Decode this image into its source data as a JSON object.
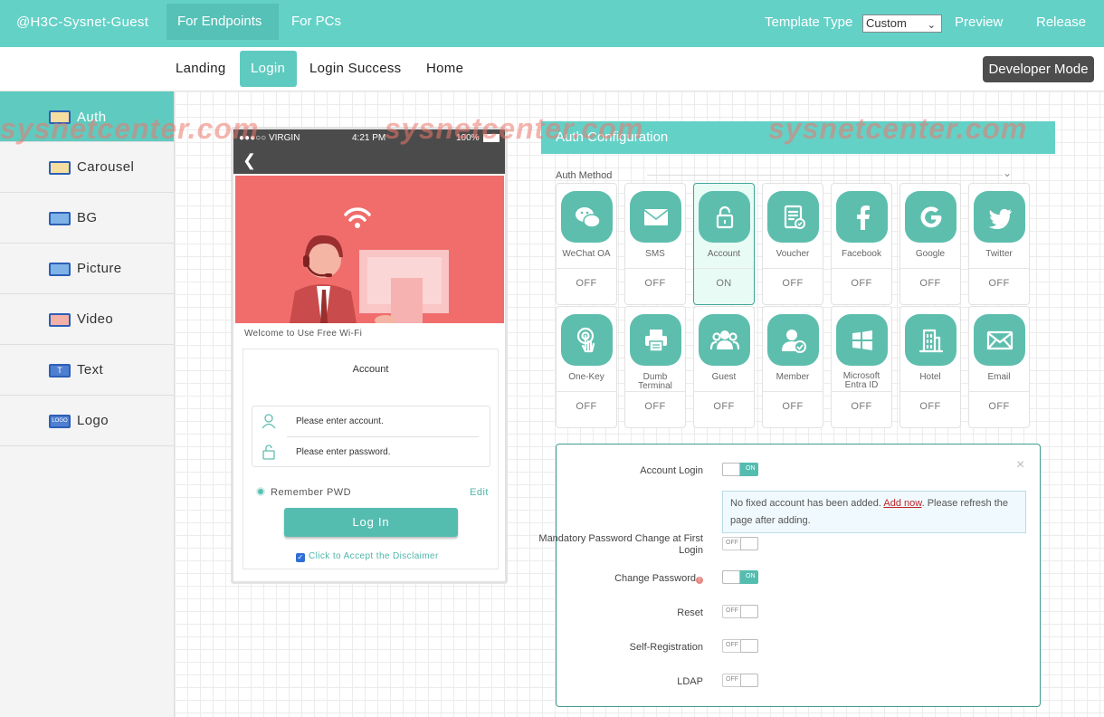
{
  "topbar": {
    "brand": "@H3C-Sysnet-Guest",
    "tabs": [
      "For Endpoints",
      "For PCs"
    ],
    "template_type_label": "Template Type",
    "template_type_value": "Custom",
    "preview": "Preview",
    "release": "Release"
  },
  "pages": {
    "tabs": [
      "Landing",
      "Login",
      "Login Success",
      "Home"
    ],
    "developer_mode": "Developer Mode"
  },
  "sidebar": {
    "items": [
      {
        "label": "Auth"
      },
      {
        "label": "Carousel"
      },
      {
        "label": "BG"
      },
      {
        "label": "Picture"
      },
      {
        "label": "Video"
      },
      {
        "label": "Text"
      },
      {
        "label": "Logo"
      }
    ]
  },
  "phone": {
    "carrier": "●●●○○ VIRGIN",
    "time": "4:21 PM",
    "battery": "100%",
    "welcome": "Welcome to Use Free Wi-Fi",
    "card_title": "Account",
    "account_placeholder": "Please enter account.",
    "password_placeholder": "Please enter password.",
    "remember": "Remember PWD",
    "edit": "Edit",
    "login_button": "Log In",
    "disclaimer": "Click to Accept the Disclaimer"
  },
  "auth": {
    "header": "Auth Configuration",
    "method_label": "Auth Method",
    "accent": "#5ebeae",
    "methods": [
      {
        "name": "WeChat OA",
        "state": "OFF",
        "icon": "wechat-icon"
      },
      {
        "name": "SMS",
        "state": "OFF",
        "icon": "envelope-icon"
      },
      {
        "name": "Account",
        "state": "ON",
        "icon": "lock-icon"
      },
      {
        "name": "Voucher",
        "state": "OFF",
        "icon": "voucher-icon"
      },
      {
        "name": "Facebook",
        "state": "OFF",
        "icon": "facebook-icon"
      },
      {
        "name": "Google",
        "state": "OFF",
        "icon": "google-icon"
      },
      {
        "name": "Twitter",
        "state": "OFF",
        "icon": "twitter-icon"
      },
      {
        "name": "One-Key",
        "state": "OFF",
        "icon": "touch-icon"
      },
      {
        "name": "Dumb Terminal",
        "state": "OFF",
        "icon": "printer-icon"
      },
      {
        "name": "Guest",
        "state": "OFF",
        "icon": "group-icon"
      },
      {
        "name": "Member",
        "state": "OFF",
        "icon": "member-icon"
      },
      {
        "name": "Microsoft Entra ID",
        "state": "OFF",
        "icon": "windows-icon"
      },
      {
        "name": "Hotel",
        "state": "OFF",
        "icon": "building-icon"
      },
      {
        "name": "Email",
        "state": "OFF",
        "icon": "mail-icon"
      }
    ]
  },
  "settings": {
    "rows": [
      {
        "label": "Account Login",
        "state": "ON"
      },
      {
        "label": "Mandatory Password Change at First Login",
        "state": "OFF"
      },
      {
        "label": "Change Password",
        "state": "ON"
      },
      {
        "label": "Reset",
        "state": "OFF"
      },
      {
        "label": "Self-Registration",
        "state": "OFF"
      },
      {
        "label": "LDAP",
        "state": "OFF"
      }
    ],
    "notice_before": "No fixed account has been added. ",
    "notice_link": "Add now",
    "notice_after": ". Please refresh the page after adding."
  },
  "watermark": "sysnetcenter.com"
}
